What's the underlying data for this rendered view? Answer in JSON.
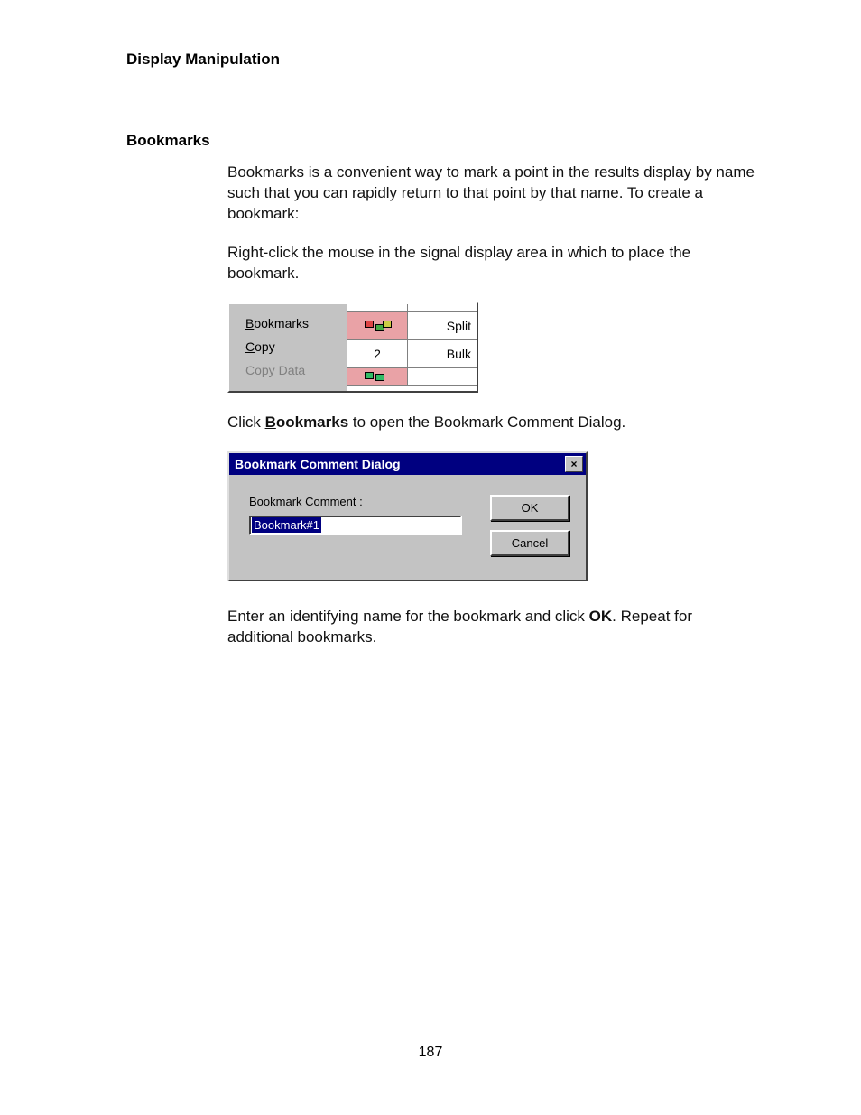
{
  "header": {
    "title": "Display Manipulation"
  },
  "section": {
    "title": "Bookmarks"
  },
  "paragraphs": {
    "intro": "Bookmarks is a convenient way to mark a point in the results display by name such that you can rapidly return to that point by that name. To create a bookmark:",
    "rightclick": "Right-click the mouse in the signal display area in which to place the bookmark.",
    "click_pre": "Click ",
    "click_bold_letter": "B",
    "click_bold_rest": "ookmarks",
    "click_post": " to open the Bookmark Comment Dialog.",
    "enter_pre": "Enter an identifying name for the bookmark and click ",
    "enter_bold": "OK",
    "enter_post": ". Repeat for additional bookmarks."
  },
  "context_menu": {
    "bookmarks_letter": "B",
    "bookmarks_rest": "ookmarks",
    "copy_letter": "C",
    "copy_rest": "opy",
    "copydata_pre": "Copy ",
    "copydata_letter": "D",
    "copydata_rest": "ata",
    "grid": {
      "row1_b": "Split",
      "row2_a": "2",
      "row2_b": "Bulk"
    }
  },
  "dialog": {
    "title": "Bookmark Comment Dialog",
    "close": "×",
    "label": "Bookmark Comment :",
    "input_value": "Bookmark#1",
    "ok": "OK",
    "cancel": "Cancel"
  },
  "page_number": "187"
}
